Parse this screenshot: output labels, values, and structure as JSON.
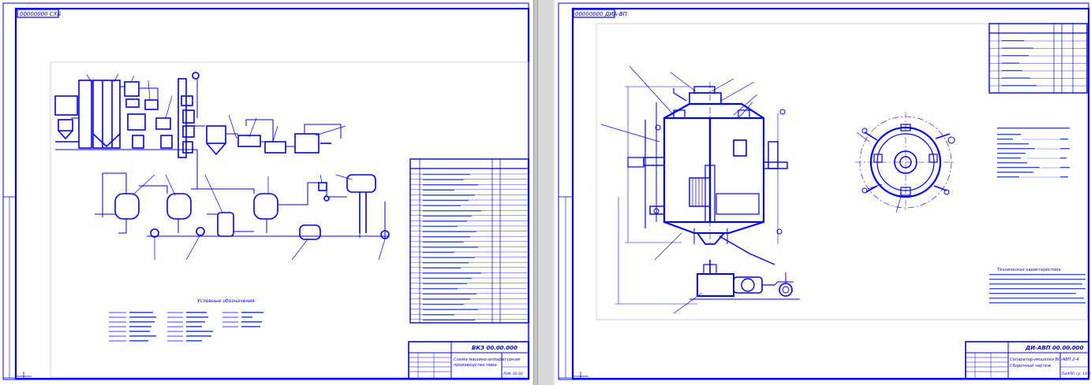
{
  "colors": {
    "line": "#0000ff",
    "frame": "#0000ff",
    "bg": "#ffffff",
    "thin": "#000080"
  },
  "left_sheet": {
    "corner_stamp": "00000000 СХБ",
    "legend_title": "Условные обозначения",
    "title_block": {
      "designation": "ВКЗ 00.00.000",
      "name_line1": "Схема машино-аппаратурная",
      "name_line2": "производства пива",
      "sheet_code": "ЛЭК-30-02"
    }
  },
  "right_sheet": {
    "corner_stamp": "00000000 ДИА-ВП",
    "notes_title": "Техническая характеристика",
    "title_block": {
      "designation": "ДИ-АВП 00.00.000",
      "name_line1": "Сепаратор-мешалка ВС-АВП 2-4",
      "name_line2": "Сборочный чертеж",
      "sheet_code": "ПиАПП гр. 14.10"
    }
  }
}
